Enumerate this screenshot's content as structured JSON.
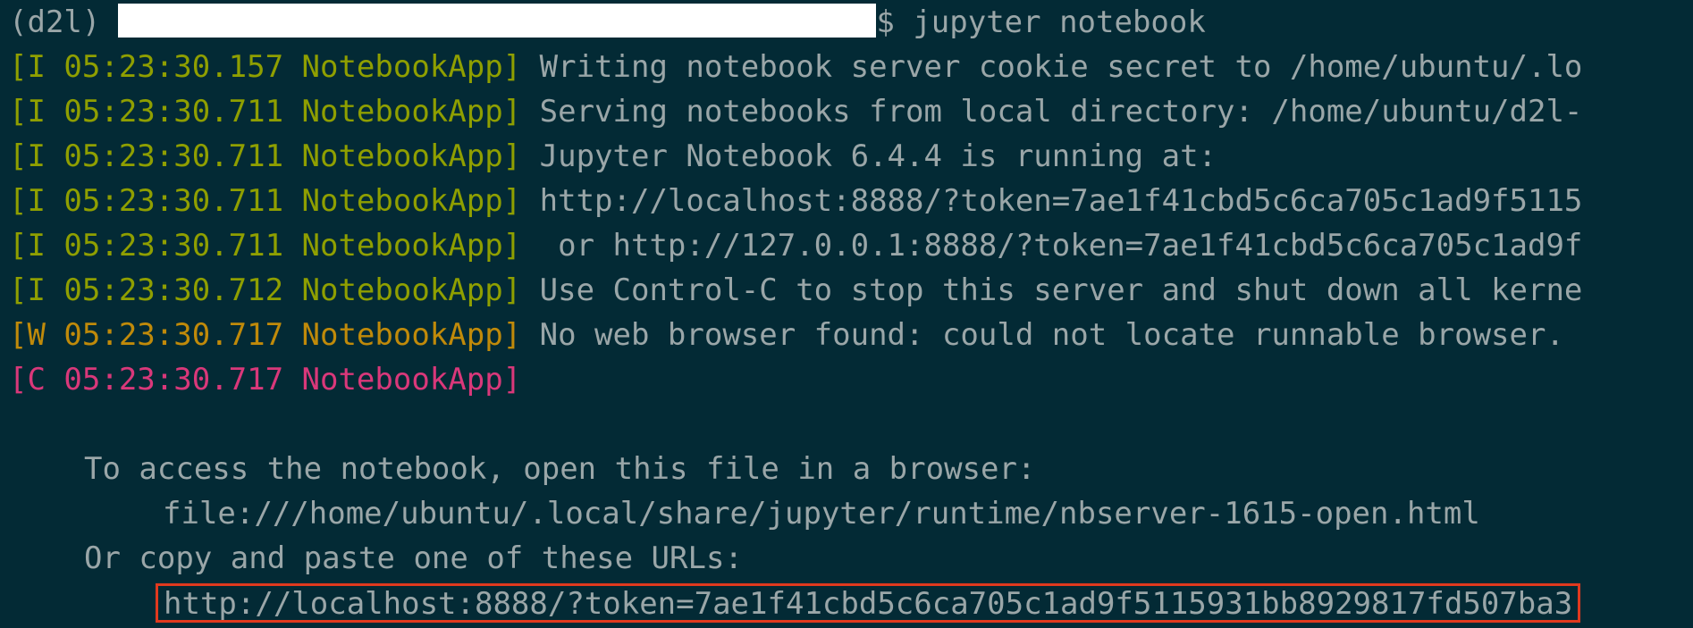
{
  "prompt": {
    "env": "(d2l)",
    "symbol": "$",
    "command": "jupyter notebook"
  },
  "logs": [
    {
      "prefix": "[I 05:23:30.157 NotebookApp]",
      "level": "info",
      "message": " Writing notebook server cookie secret to /home/ubuntu/.lo"
    },
    {
      "prefix": "[I 05:23:30.711 NotebookApp]",
      "level": "info",
      "message": " Serving notebooks from local directory: /home/ubuntu/d2l-"
    },
    {
      "prefix": "[I 05:23:30.711 NotebookApp]",
      "level": "info",
      "message": " Jupyter Notebook 6.4.4 is running at:"
    },
    {
      "prefix": "[I 05:23:30.711 NotebookApp]",
      "level": "info",
      "message": " http://localhost:8888/?token=7ae1f41cbd5c6ca705c1ad9f5115"
    },
    {
      "prefix": "[I 05:23:30.711 NotebookApp]",
      "level": "info",
      "message": "  or http://127.0.0.1:8888/?token=7ae1f41cbd5c6ca705c1ad9f"
    },
    {
      "prefix": "[I 05:23:30.712 NotebookApp]",
      "level": "info",
      "message": " Use Control-C to stop this server and shut down all kerne"
    },
    {
      "prefix": "[W 05:23:30.717 NotebookApp]",
      "level": "warn",
      "message": " No web browser found: could not locate runnable browser."
    },
    {
      "prefix": "[C 05:23:30.717 NotebookApp]",
      "level": "crit",
      "message": ""
    }
  ],
  "access": {
    "line1": "To access the notebook, open this file in a browser:",
    "file_path": "file:///home/ubuntu/.local/share/jupyter/runtime/nbserver-1615-open.html",
    "line2": "Or copy and paste one of these URLs:",
    "url": "http://localhost:8888/?token=7ae1f41cbd5c6ca705c1ad9f5115931bb8929817fd507ba3"
  },
  "colors": {
    "background": "#032a35",
    "info": "#8f9f00",
    "warn": "#c08a0a",
    "crit": "#d9387a",
    "text": "#9aa6a8",
    "highlight_border": "#e0391e"
  }
}
